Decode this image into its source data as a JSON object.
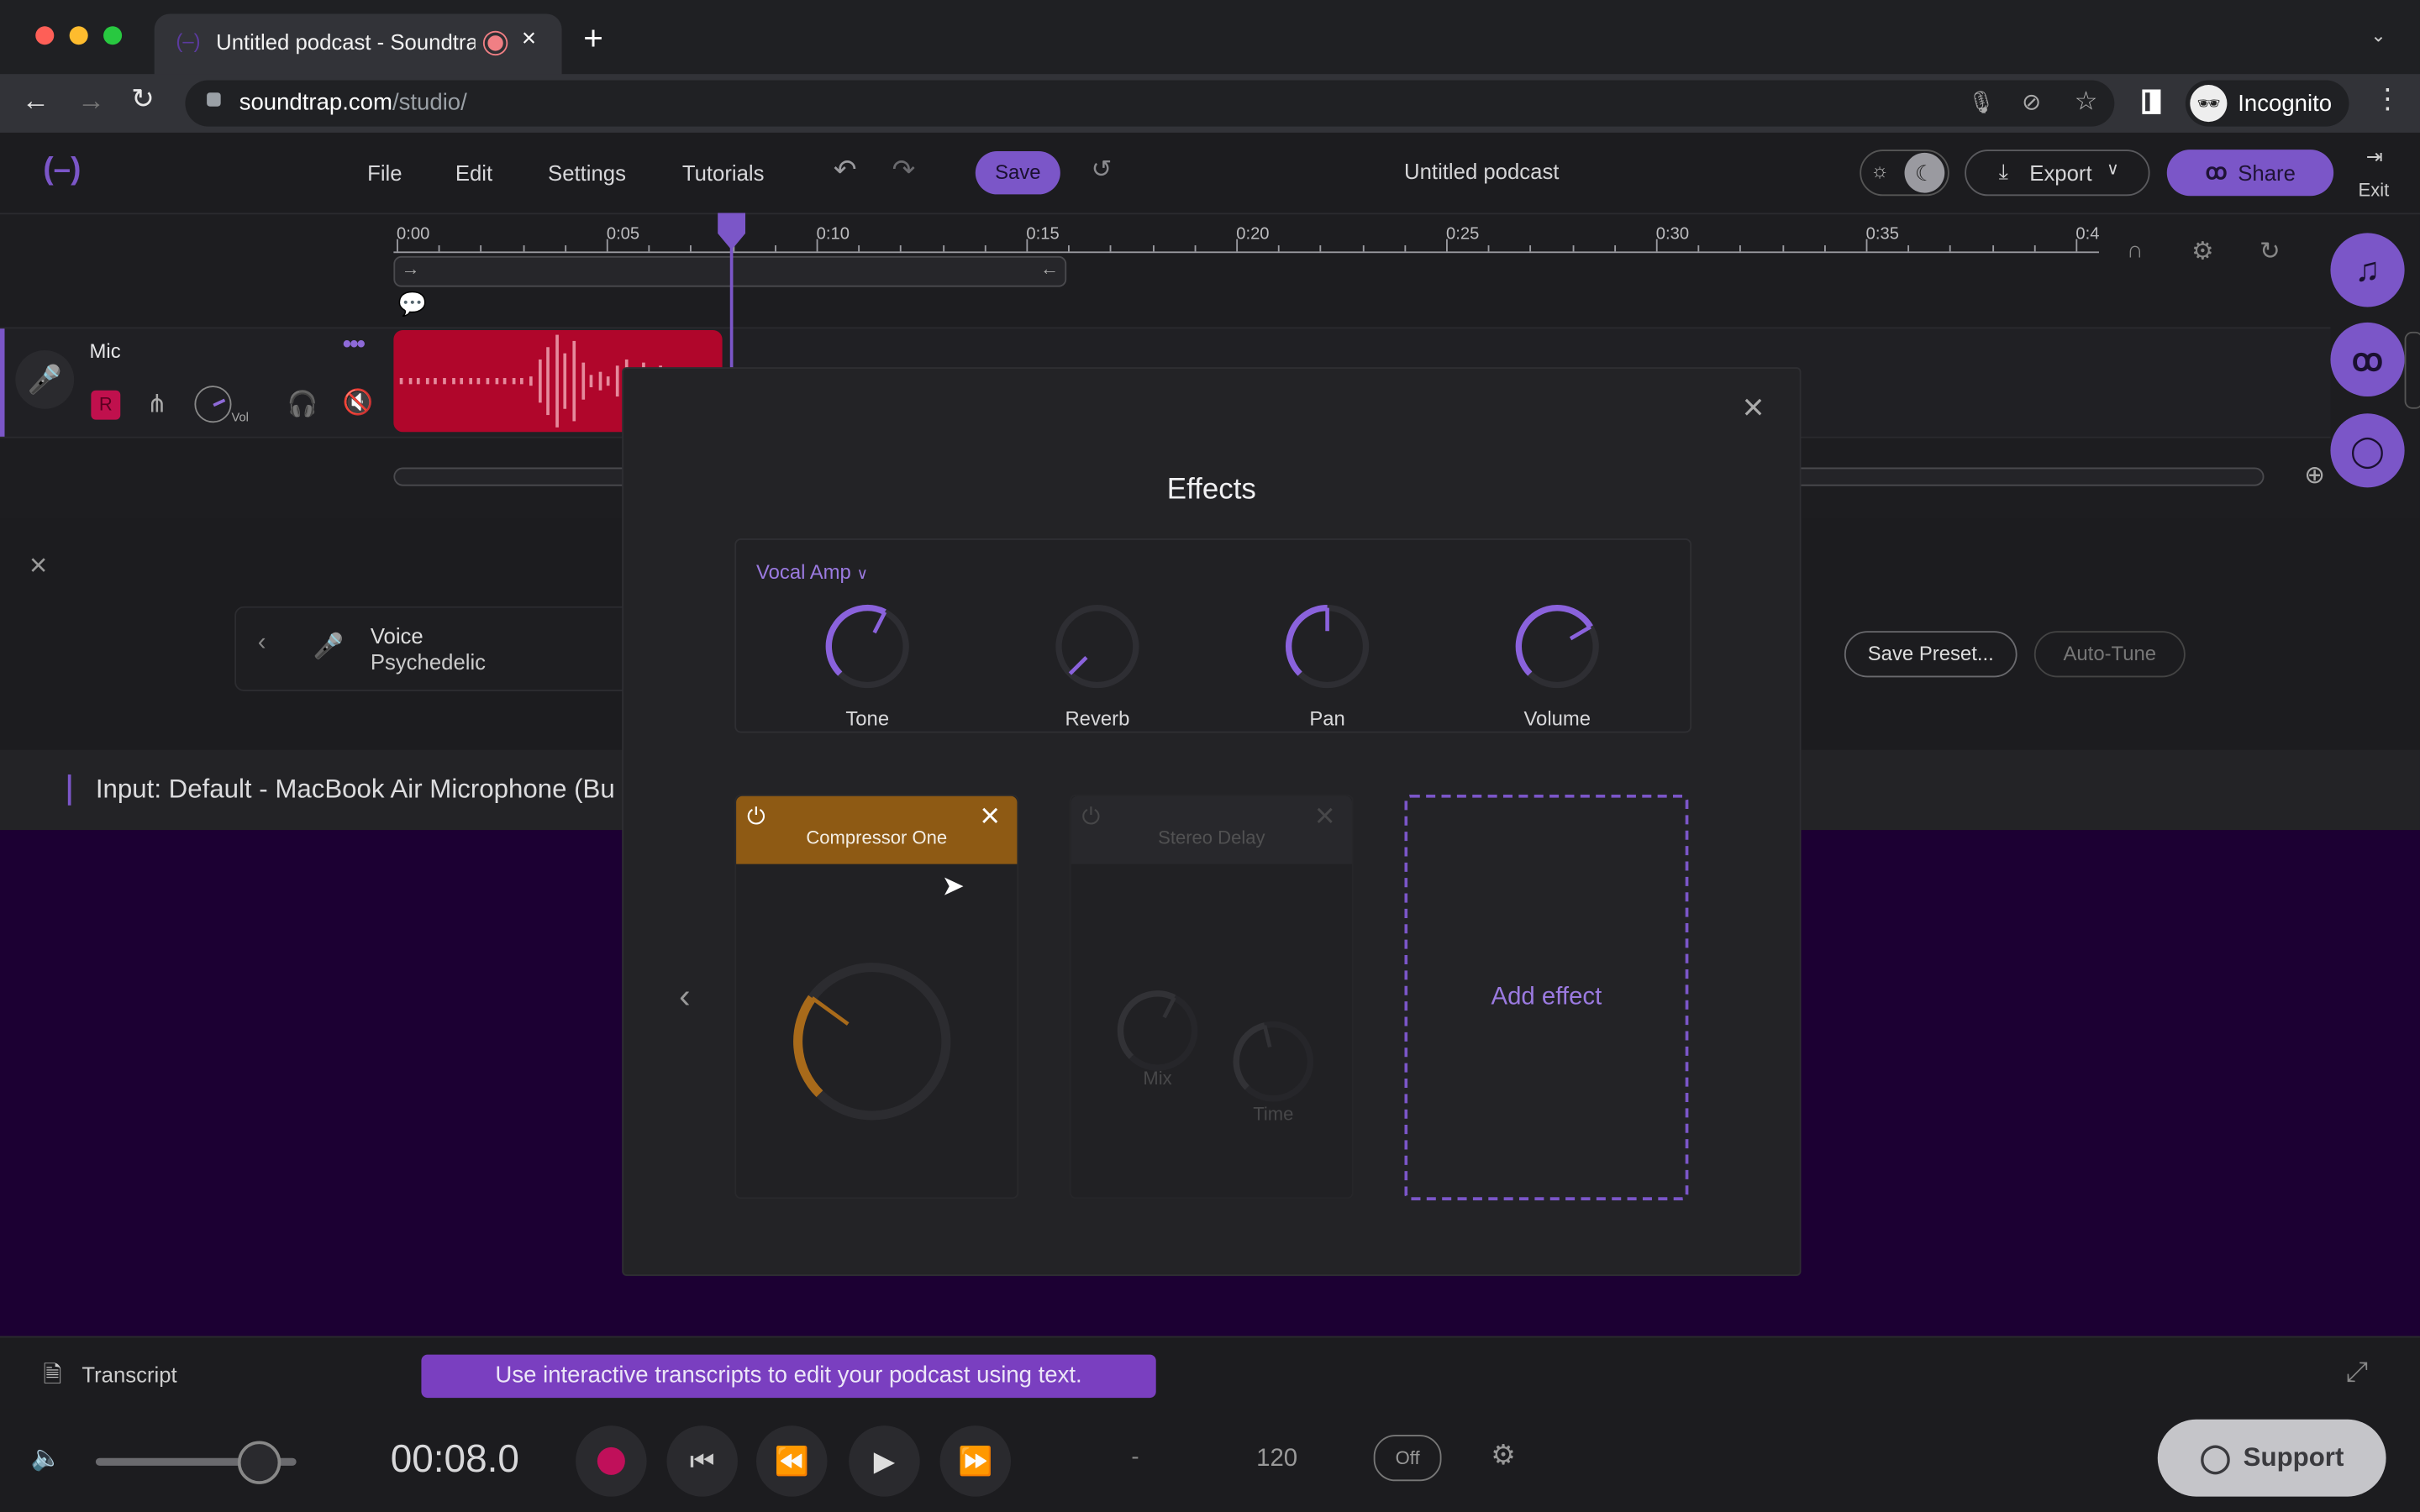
{
  "browser": {
    "tab_title": "Untitled podcast - Soundtrap",
    "new_tab_label": "+",
    "url_host": "soundtrap.com",
    "url_path": "/studio/",
    "profile_label": "Incognito"
  },
  "app": {
    "menu": [
      "File",
      "Edit",
      "Settings",
      "Tutorials"
    ],
    "save_label": "Save",
    "project_title": "Untitled podcast",
    "export_label": "Export",
    "share_label": "Share",
    "exit_label": "Exit",
    "accent_color": "#7b56c8"
  },
  "timeline": {
    "ticks": [
      "0:00",
      "0:05",
      "0:10",
      "0:15",
      "0:20",
      "0:25",
      "0:30",
      "0:35",
      "0:4"
    ],
    "playhead_seconds": 8.0
  },
  "track": {
    "name": "Mic",
    "record_label": "R",
    "vol_label": "Vol",
    "clip_color": "#b0062b"
  },
  "fx_panel": {
    "preset_category": "Voice",
    "preset_name": "Psychedelic",
    "save_preset_label": "Save Preset...",
    "autotune_label": "Auto-Tune",
    "input_label": "Input: Default - MacBook Air Microphone (Bu"
  },
  "effects_modal": {
    "title": "Effects",
    "amp_name": "Vocal Amp",
    "amp_knobs": [
      {
        "label": "Tone",
        "value": 0.6
      },
      {
        "label": "Reverb",
        "value": 0.0
      },
      {
        "label": "Pan",
        "value": 0.5
      },
      {
        "label": "Volume",
        "value": 0.72
      }
    ],
    "cards": [
      {
        "name": "Compressor One",
        "enabled": true,
        "color": "#8e5a14",
        "knobs": [
          {
            "label": "",
            "value": 0.3
          }
        ]
      },
      {
        "name": "Stereo Delay",
        "enabled": false,
        "color": "#2d2d31",
        "knobs": [
          {
            "label": "Mix",
            "value": 0.6
          },
          {
            "label": "Time",
            "value": 0.45
          }
        ]
      }
    ],
    "add_effect_label": "Add effect"
  },
  "bottom": {
    "transcript_label": "Transcript",
    "banner_text": "Use interactive transcripts to edit your podcast using text.",
    "master_volume": 0.8,
    "time_display": "00:08.0",
    "key_display": "-",
    "tempo": "120",
    "metronome_label": "Off",
    "support_label": "Support"
  }
}
